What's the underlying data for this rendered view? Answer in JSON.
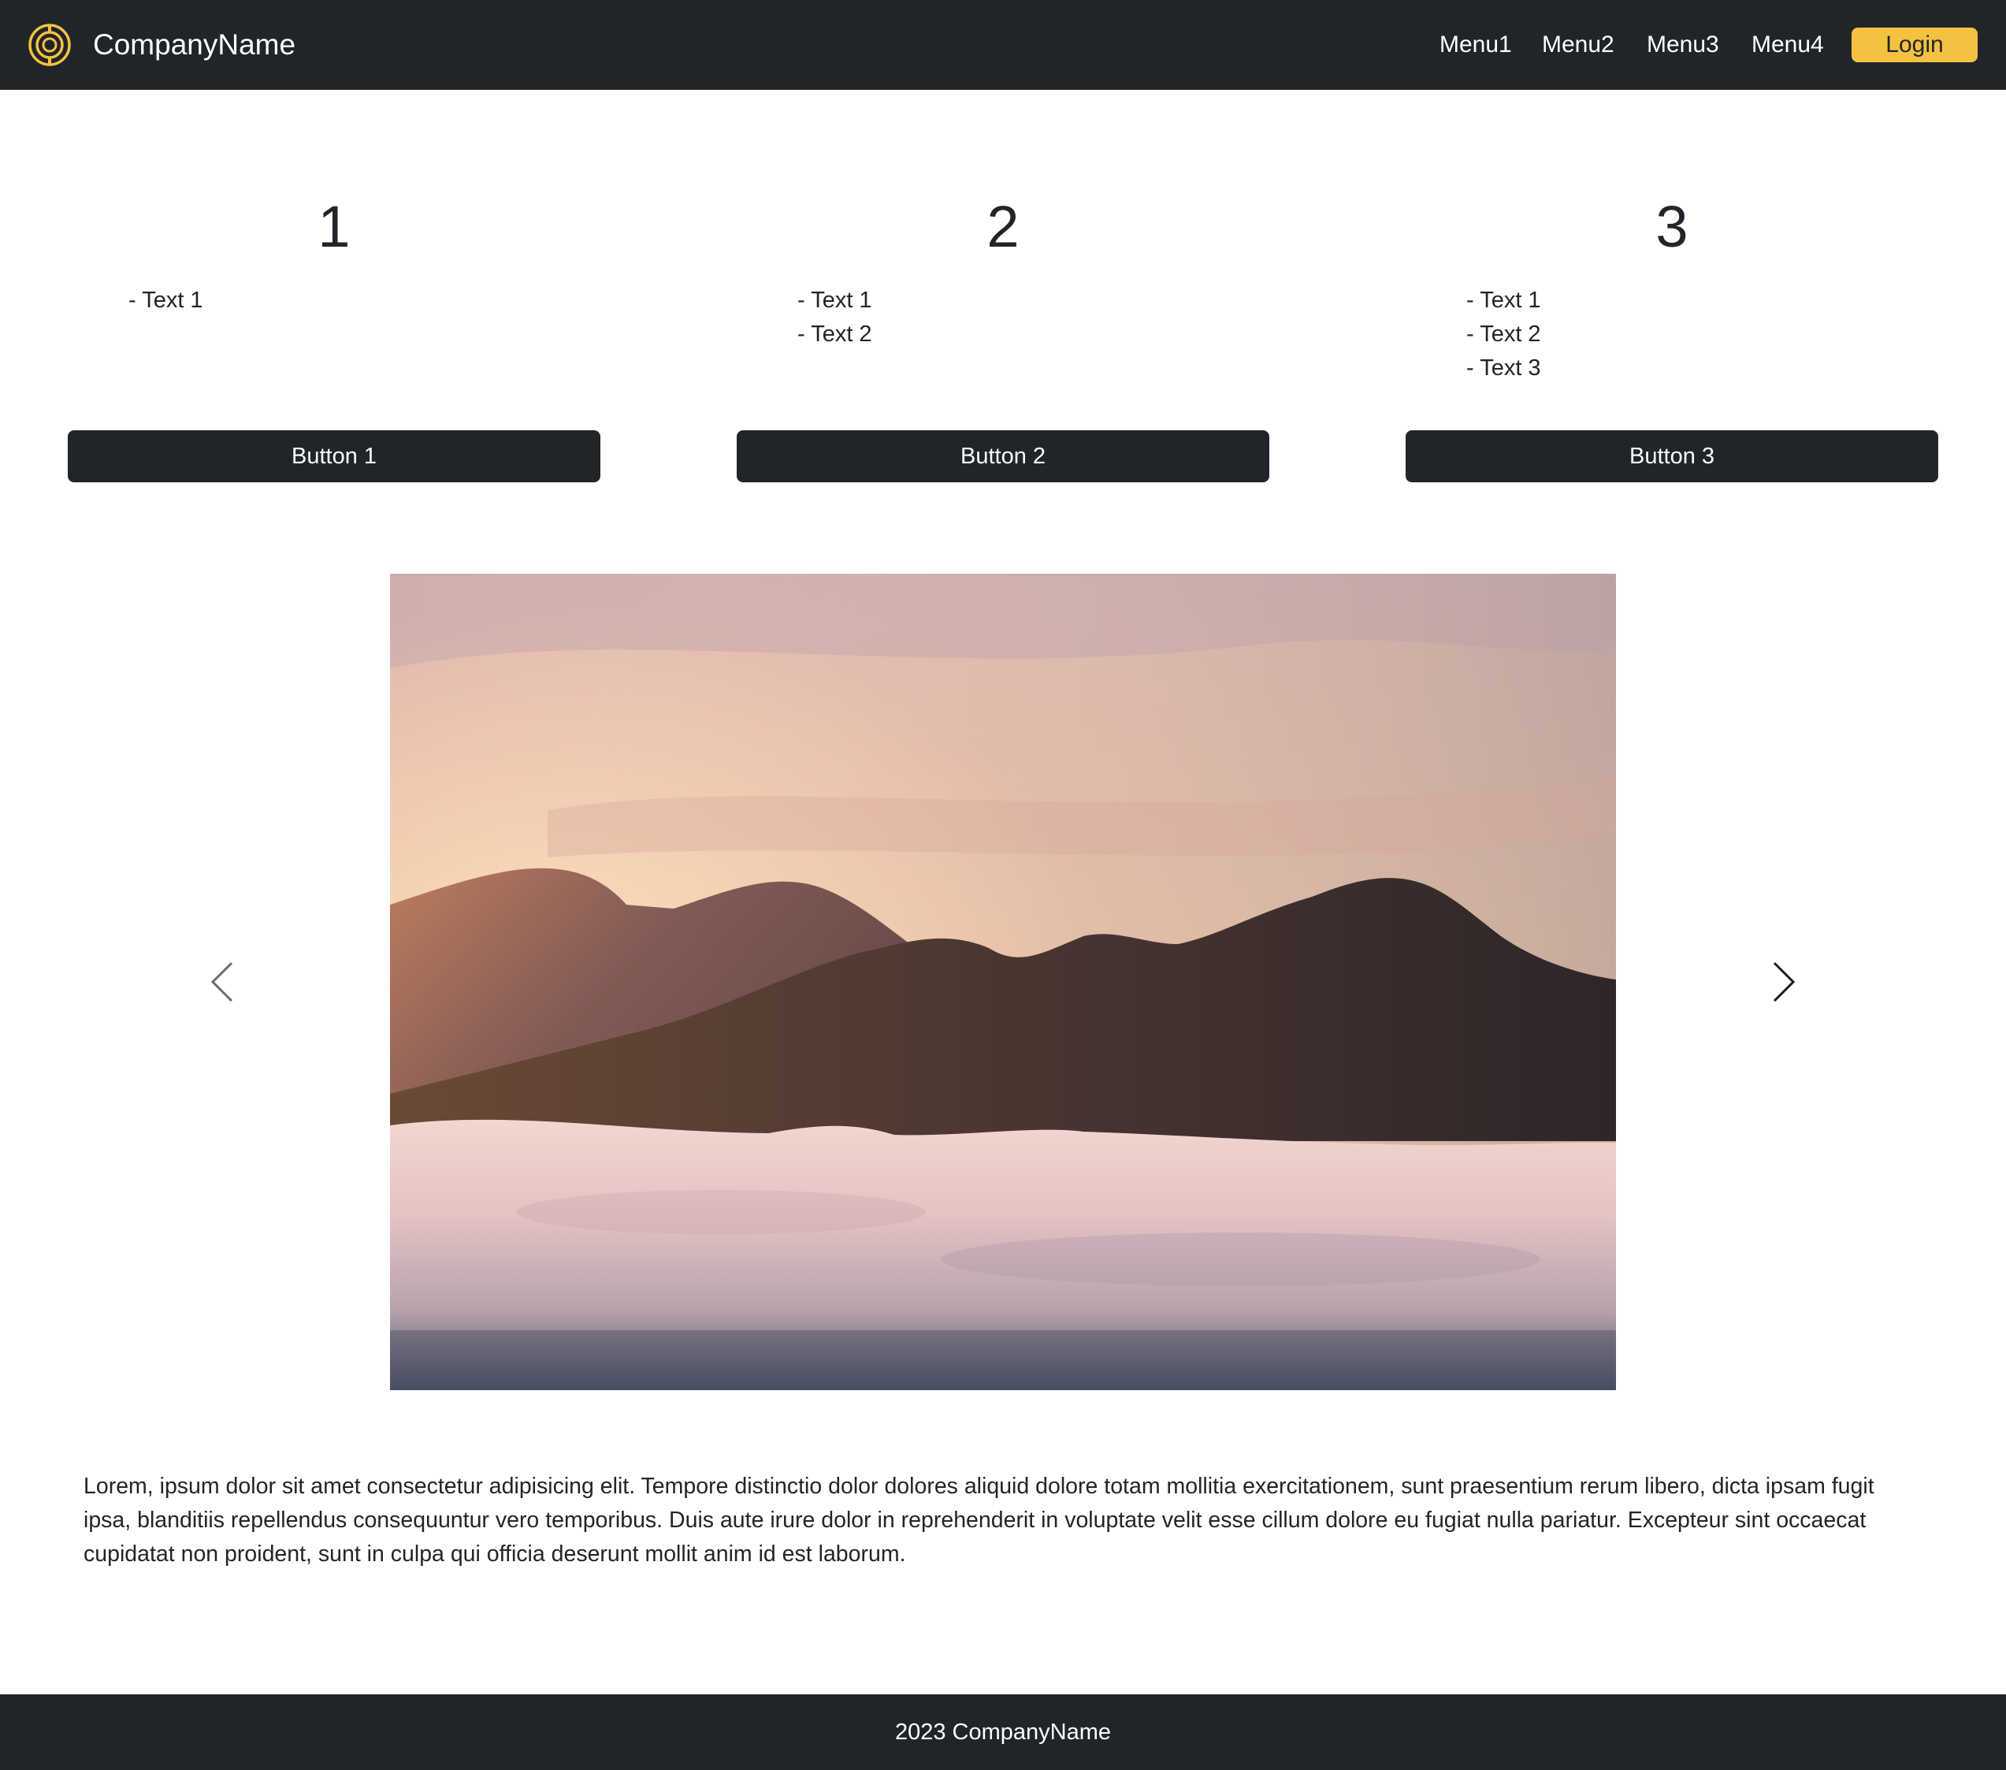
{
  "navbar": {
    "brand_name": "CompanyName",
    "logo_icon": "company-logo-icon",
    "menu": [
      "Menu1",
      "Menu2",
      "Menu3",
      "Menu4"
    ],
    "login_label": "Login",
    "colors": {
      "background": "#212529",
      "accent": "#f4c240"
    }
  },
  "columns": [
    {
      "number": "1",
      "items": [
        "- Text 1"
      ],
      "button_label": "Button 1"
    },
    {
      "number": "2",
      "items": [
        "- Text 1",
        "- Text 2"
      ],
      "button_label": "Button 2"
    },
    {
      "number": "3",
      "items": [
        "- Text 1",
        "- Text 2",
        "- Text 3"
      ],
      "button_label": "Button 3"
    }
  ],
  "carousel": {
    "prev_icon": "chevron-left-icon",
    "next_icon": "chevron-right-icon",
    "image_subject": "mountains above a sea of clouds at sunrise"
  },
  "body_text": "Lorem, ipsum dolor sit amet consectetur adipisicing elit. Tempore distinctio dolor dolores aliquid dolore totam mollitia exercitationem, sunt praesentium rerum libero, dicta ipsam fugit ipsa, blanditiis repellendus consequuntur vero temporibus. Duis aute irure dolor in reprehenderit in voluptate velit esse cillum dolore eu fugiat nulla pariatur. Excepteur sint occaecat cupidatat non proident, sunt in culpa qui officia deserunt mollit anim id est laborum.",
  "footer": {
    "text": "2023 CompanyName"
  }
}
